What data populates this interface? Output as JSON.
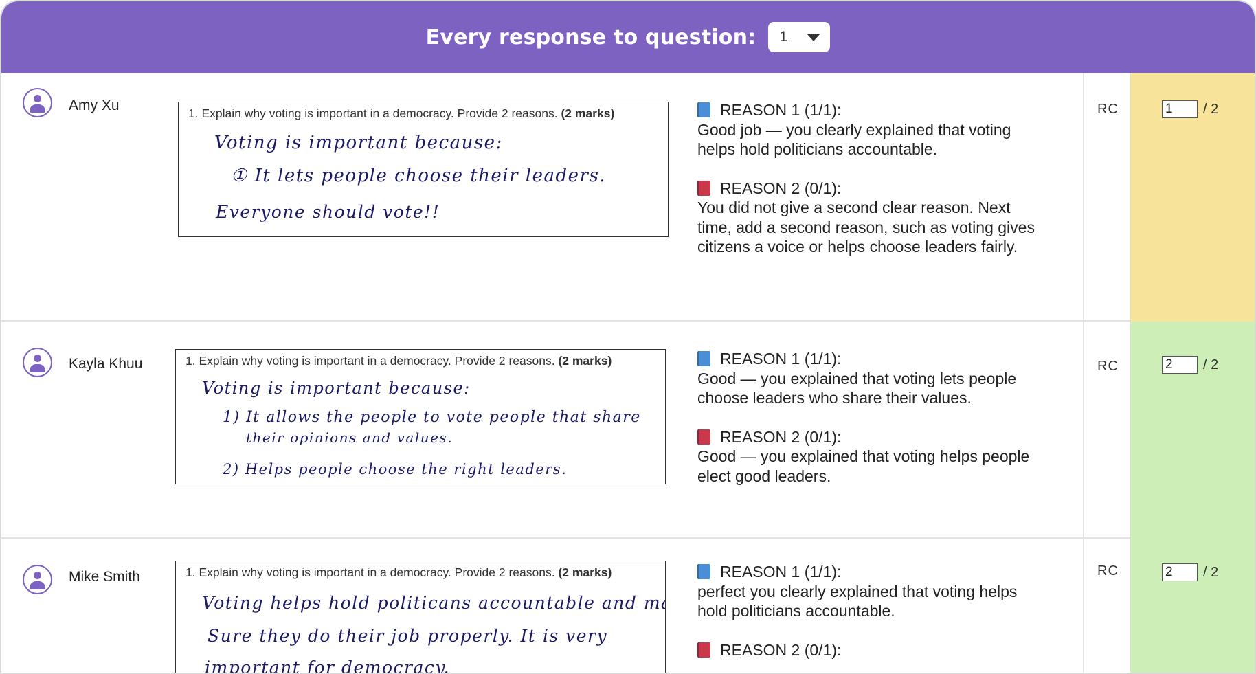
{
  "header": {
    "title": "Every response to question:",
    "question_select": "1"
  },
  "question_text": "1. Explain why voting is important in a democracy. Provide 2 reasons.",
  "question_marks": "(2 marks)",
  "responses": [
    {
      "student": "Amy Xu",
      "handwriting": [
        "Voting is important because:",
        "① It lets people choose their leaders.",
        "Everyone should vote!!"
      ],
      "feedback": [
        {
          "heading": "REASON 1 (1/1):",
          "text": "Good job — you clearly explained that voting helps hold politicians accountable.",
          "book_color": "#4a8fd6"
        },
        {
          "heading": "REASON 2 (0/1):",
          "text": "You did not give a second clear reason. Next time, add a second reason, such as voting gives citizens a voice or helps choose leaders fairly.",
          "book_color": "#c9394b"
        }
      ],
      "grader": "RC",
      "score": "1",
      "max_score": "/ 2",
      "score_color": "#f7e399"
    },
    {
      "student": "Kayla Khuu",
      "handwriting": [
        "Voting is important because:",
        "1) It allows the people to vote people that share",
        "their opinions and values.",
        "2) Helps people choose the right leaders."
      ],
      "feedback": [
        {
          "heading": "REASON 1 (1/1):",
          "text": "Good — you explained that voting lets people choose leaders who share their values.",
          "book_color": "#4a8fd6"
        },
        {
          "heading": "REASON 2 (0/1):",
          "text": "Good — you explained that voting helps people elect good leaders.",
          "book_color": "#c9394b"
        }
      ],
      "grader": "RC",
      "score": "2",
      "max_score": "/ 2",
      "score_color": "#cdeeb7"
    },
    {
      "student": "Mike Smith",
      "handwriting": [
        "Voting helps hold politicans accountable and make",
        "Sure they do their job properly. It is very",
        "important for democracy."
      ],
      "feedback": [
        {
          "heading": "REASON 1 (1/1):",
          "text": "perfect you clearly explained that voting helps hold politicians accountable.",
          "book_color": "#4a8fd6"
        },
        {
          "heading": "REASON 2 (0/1):",
          "text": "",
          "book_color": "#c9394b"
        }
      ],
      "grader": "RC",
      "score": "2",
      "max_score": "/ 2",
      "score_color": "#cdeeb7"
    }
  ]
}
